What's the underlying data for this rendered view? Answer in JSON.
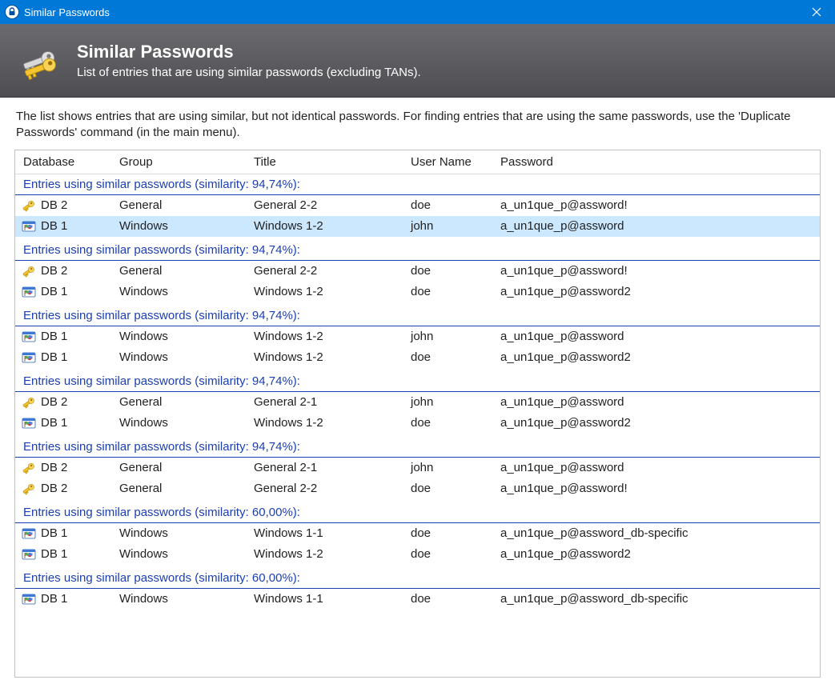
{
  "window": {
    "title": "Similar Passwords"
  },
  "header": {
    "heading": "Similar Passwords",
    "subheading": "List of entries that are using similar passwords (excluding TANs)."
  },
  "description": "The list shows entries that are using similar, but not identical passwords. For finding entries that are using the same passwords, use the 'Duplicate Passwords' command (in the main menu).",
  "columns": {
    "database": "Database",
    "group": "Group",
    "title": "Title",
    "username": "User Name",
    "password": "Password"
  },
  "groups": [
    {
      "label": "Entries using similar passwords (similarity: 94,74%):",
      "entries": [
        {
          "icon": "key",
          "database": "DB 2",
          "group": "General",
          "title": "General 2-2",
          "username": "doe",
          "password": "a_un1que_p@assword!",
          "selected": false
        },
        {
          "icon": "windows",
          "database": "DB 1",
          "group": "Windows",
          "title": "Windows 1-2",
          "username": "john",
          "password": "a_un1que_p@assword",
          "selected": true
        }
      ]
    },
    {
      "label": "Entries using similar passwords (similarity: 94,74%):",
      "entries": [
        {
          "icon": "key",
          "database": "DB 2",
          "group": "General",
          "title": "General 2-2",
          "username": "doe",
          "password": "a_un1que_p@assword!"
        },
        {
          "icon": "windows",
          "database": "DB 1",
          "group": "Windows",
          "title": "Windows 1-2",
          "username": "doe",
          "password": "a_un1que_p@assword2"
        }
      ]
    },
    {
      "label": "Entries using similar passwords (similarity: 94,74%):",
      "entries": [
        {
          "icon": "windows",
          "database": "DB 1",
          "group": "Windows",
          "title": "Windows 1-2",
          "username": "john",
          "password": "a_un1que_p@assword"
        },
        {
          "icon": "windows",
          "database": "DB 1",
          "group": "Windows",
          "title": "Windows 1-2",
          "username": "doe",
          "password": "a_un1que_p@assword2"
        }
      ]
    },
    {
      "label": "Entries using similar passwords (similarity: 94,74%):",
      "entries": [
        {
          "icon": "key",
          "database": "DB 2",
          "group": "General",
          "title": "General 2-1",
          "username": "john",
          "password": "a_un1que_p@assword"
        },
        {
          "icon": "windows",
          "database": "DB 1",
          "group": "Windows",
          "title": "Windows 1-2",
          "username": "doe",
          "password": "a_un1que_p@assword2"
        }
      ]
    },
    {
      "label": "Entries using similar passwords (similarity: 94,74%):",
      "entries": [
        {
          "icon": "key",
          "database": "DB 2",
          "group": "General",
          "title": "General 2-1",
          "username": "john",
          "password": "a_un1que_p@assword"
        },
        {
          "icon": "key",
          "database": "DB 2",
          "group": "General",
          "title": "General 2-2",
          "username": "doe",
          "password": "a_un1que_p@assword!"
        }
      ]
    },
    {
      "label": "Entries using similar passwords (similarity: 60,00%):",
      "entries": [
        {
          "icon": "windows",
          "database": "DB 1",
          "group": "Windows",
          "title": "Windows 1-1",
          "username": "doe",
          "password": "a_un1que_p@assword_db-specific"
        },
        {
          "icon": "windows",
          "database": "DB 1",
          "group": "Windows",
          "title": "Windows 1-2",
          "username": "doe",
          "password": "a_un1que_p@assword2"
        }
      ]
    },
    {
      "label": "Entries using similar passwords (similarity: 60,00%):",
      "entries": [
        {
          "icon": "windows",
          "database": "DB 1",
          "group": "Windows",
          "title": "Windows 1-1",
          "username": "doe",
          "password": "a_un1que_p@assword_db-specific"
        }
      ]
    }
  ]
}
